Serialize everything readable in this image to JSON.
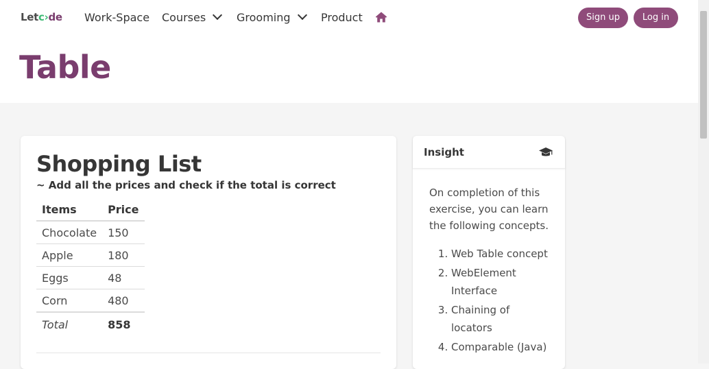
{
  "nav": {
    "logo": {
      "part1": "Let",
      "part2": "c",
      "part3": "de"
    },
    "items": [
      {
        "label": "Work-Space"
      },
      {
        "label": "Courses"
      },
      {
        "label": "Grooming"
      },
      {
        "label": "Product"
      }
    ],
    "home_icon": "home-icon",
    "signup_label": "Sign up",
    "login_label": "Log in"
  },
  "page": {
    "title": "Table"
  },
  "shopping": {
    "title": "Shopping List",
    "subtitle": "~ Add all the prices and check if the total is correct",
    "headers": [
      "Items",
      "Price"
    ],
    "rows": [
      {
        "item": "Chocolate",
        "price": "150"
      },
      {
        "item": "Apple",
        "price": "180"
      },
      {
        "item": "Eggs",
        "price": "48"
      },
      {
        "item": "Corn",
        "price": "480"
      }
    ],
    "total_label": "Total",
    "total_value": "858"
  },
  "insight": {
    "title": "Insight",
    "icon": "graduation-cap-icon",
    "intro": "On completion of this exercise, you can learn the following concepts.",
    "items": [
      "Web Table concept",
      "WebElement Interface",
      "Chaining of locators",
      "Comparable (Java)"
    ]
  },
  "colors": {
    "brand": "#8f4b7a",
    "title": "#7a3d6e",
    "logo_accent": "#3dba74"
  }
}
